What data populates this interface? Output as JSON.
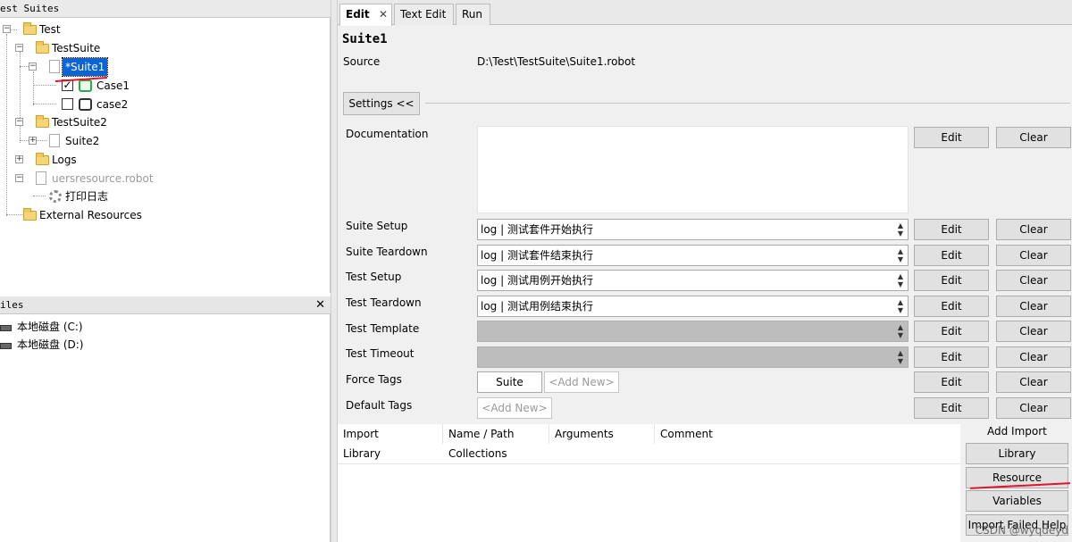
{
  "left": {
    "suites_title": "est Suites",
    "tree": {
      "test": "Test",
      "testsuite": "TestSuite",
      "suite1": "*Suite1",
      "case1": "Case1",
      "case2": "case2",
      "testsuite2": "TestSuite2",
      "suite2": "Suite2",
      "logs": "Logs",
      "resource_file": "uersresource.robot",
      "keyword": "打印日志",
      "external": "External Resources"
    },
    "files_title": "iles",
    "files_close": "✕",
    "drives": [
      "本地磁盘 (C:)",
      "本地磁盘 (D:)"
    ]
  },
  "tabs": {
    "edit": "Edit",
    "edit_close": "✕",
    "text_edit": "Text Edit",
    "run": "Run"
  },
  "suite": {
    "name": "Suite1",
    "source_label": "Source",
    "source_value": "D:\\Test\\TestSuite\\Suite1.robot"
  },
  "settings": {
    "toggle_label": "Settings <<",
    "documentation_label": "Documentation",
    "suite_setup_label": "Suite Setup",
    "suite_setup_value": "log | 测试套件开始执行",
    "suite_teardown_label": "Suite Teardown",
    "suite_teardown_value": "log | 测试套件结束执行",
    "test_setup_label": "Test Setup",
    "test_setup_value": "log | 测试用例开始执行",
    "test_teardown_label": "Test Teardown",
    "test_teardown_value": "log | 测试用例结束执行",
    "test_template_label": "Test Template",
    "test_timeout_label": "Test Timeout",
    "force_tags_label": "Force Tags",
    "force_tag_value": "Suite",
    "default_tags_label": "Default Tags",
    "add_new": "<Add New>",
    "edit": "Edit",
    "clear": "Clear"
  },
  "imports": {
    "headers": [
      "Import",
      "Name / Path",
      "Arguments",
      "Comment"
    ],
    "rows": [
      {
        "type": "Library",
        "name": "Collections"
      }
    ],
    "add_import_label": "Add Import",
    "buttons": {
      "library": "Library",
      "resource": "Resource",
      "variables": "Variables",
      "import_failed": "Import Failed Help"
    }
  },
  "watermark": "CSDN @wyqdeyd",
  "colors": {
    "selection": "#0a64d6",
    "annotation_red": "#e0142b",
    "robot_green": "#2fa74a"
  }
}
